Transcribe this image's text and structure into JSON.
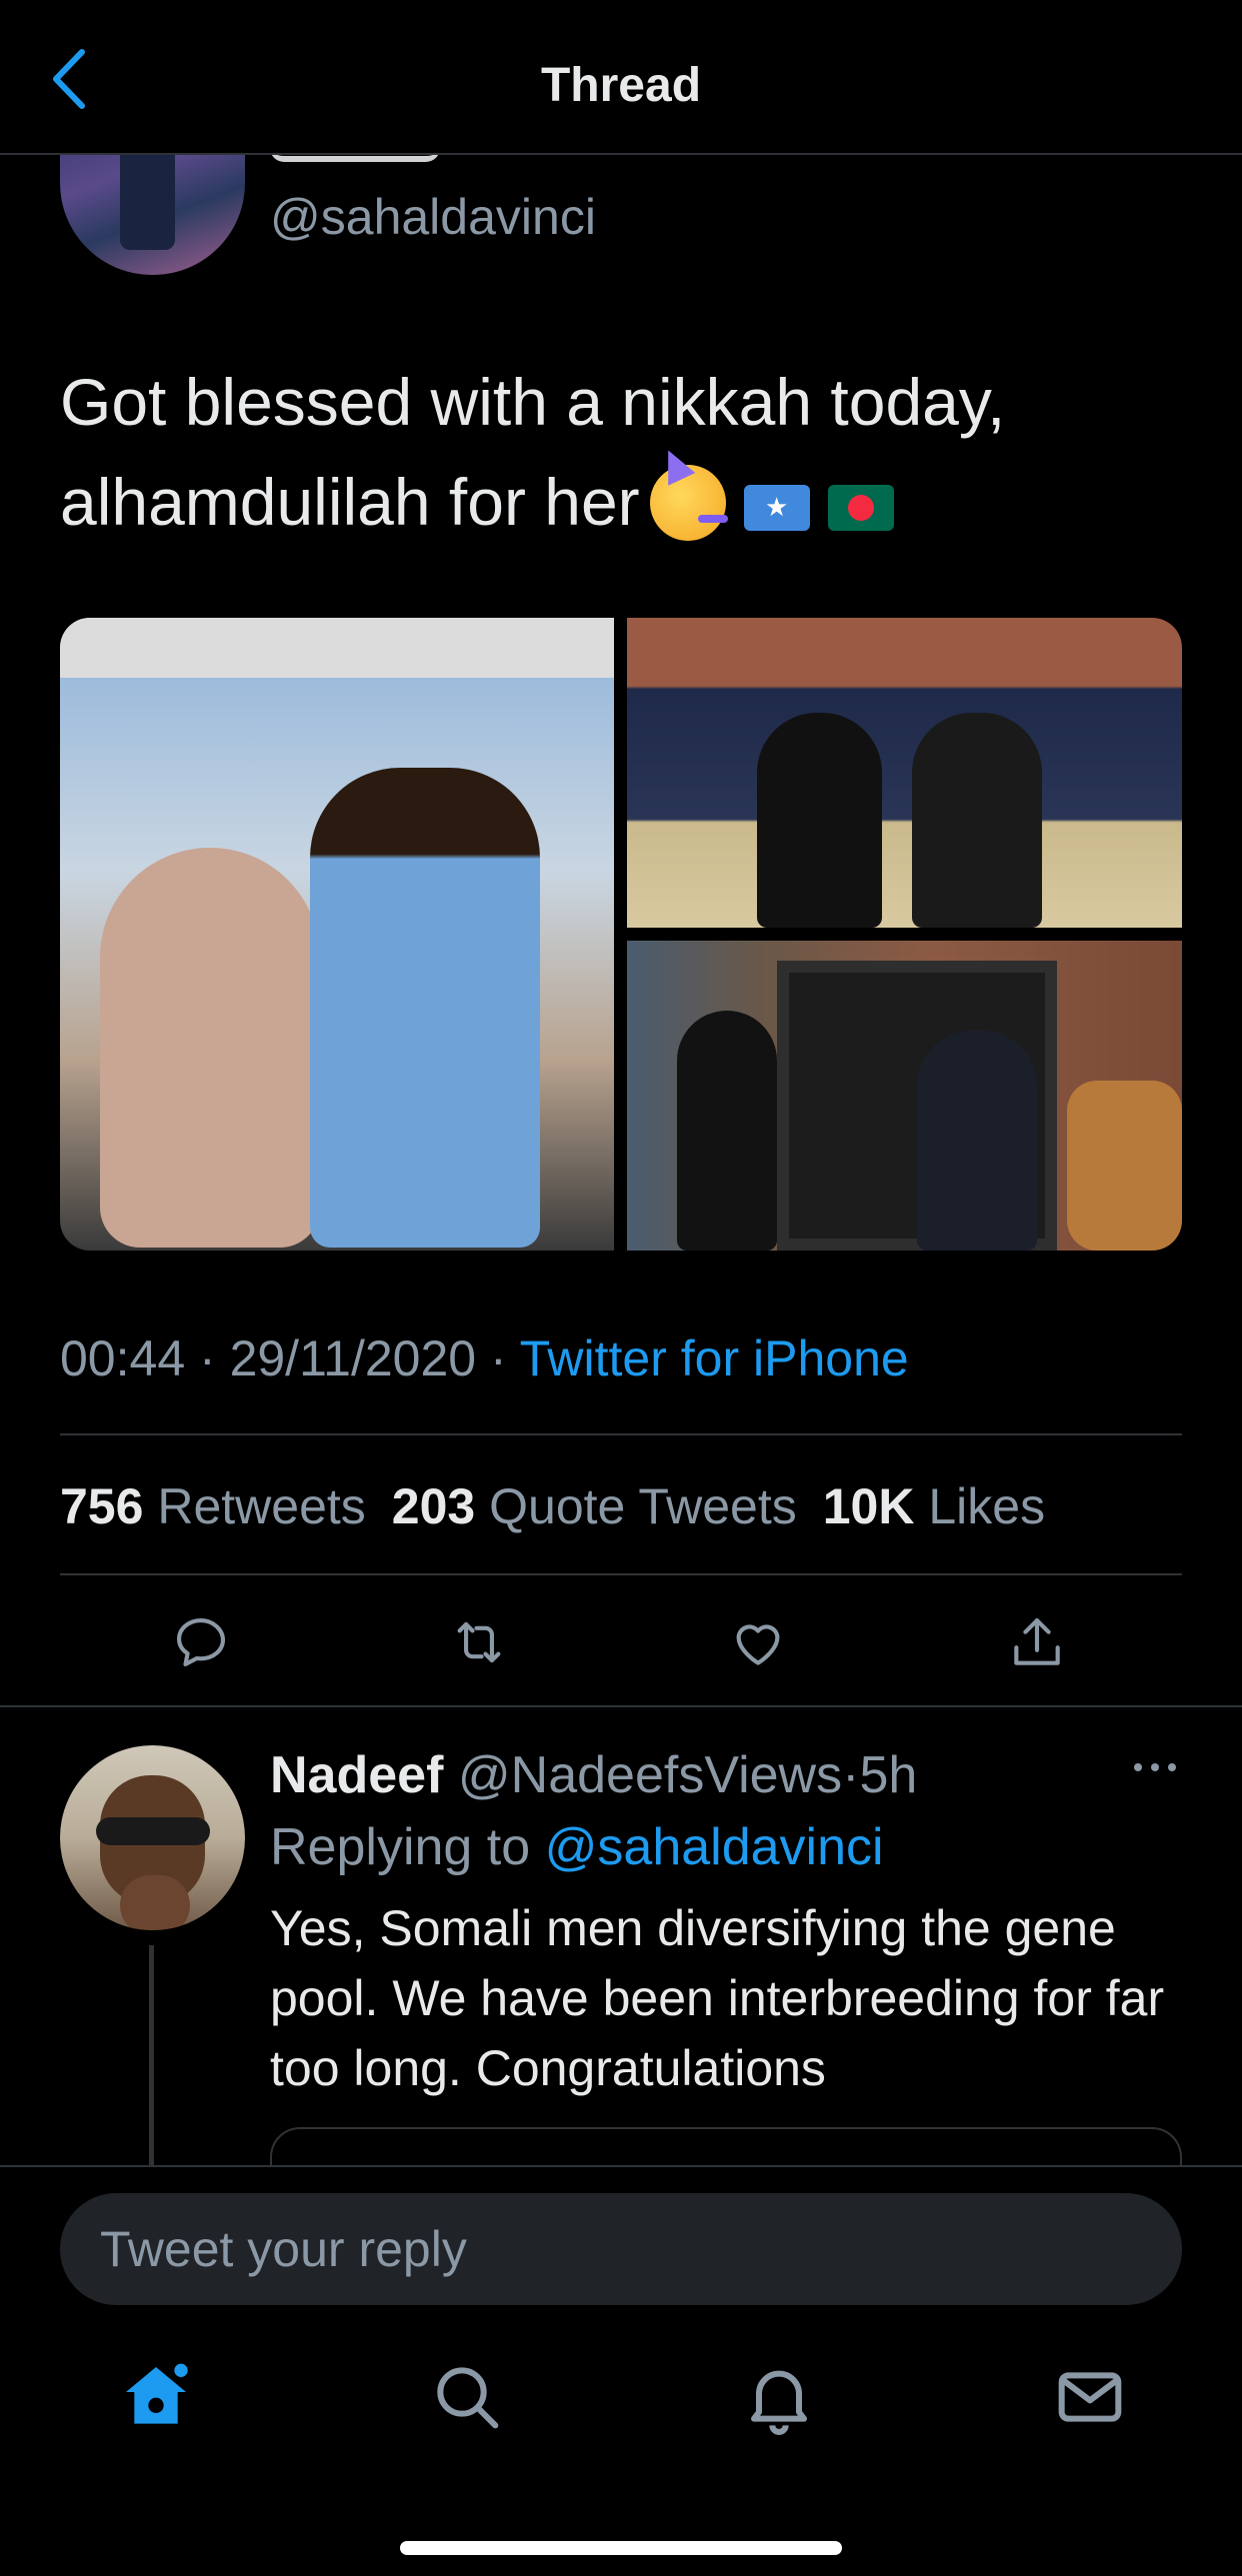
{
  "header": {
    "title": "Thread"
  },
  "tweet": {
    "handle": "@sahaldavinci",
    "text": "Got blessed with a nikkah today, alhamdulilah for her",
    "emoji_icons": [
      "partying-face-icon",
      "somalia-flag-icon",
      "bangladesh-flag-icon"
    ],
    "time": "00:44",
    "date": "29/11/2020",
    "source": "Twitter for iPhone",
    "stats": {
      "retweets_count": "756",
      "retweets_label": "Retweets",
      "quotes_count": "203",
      "quotes_label": "Quote Tweets",
      "likes_count": "10K",
      "likes_label": "Likes"
    },
    "actions": [
      "reply-icon",
      "retweet-icon",
      "like-icon",
      "share-icon"
    ]
  },
  "reply": {
    "name": "Nadeef",
    "handle": "@NadeefsViews",
    "age": "5h",
    "replying_label": "Replying to",
    "replying_to": "@sahaldavinci",
    "text": "Yes, Somali men diversifying the gene pool. We have been interbreeding for far too long. Congratulations"
  },
  "composer": {
    "placeholder": "Tweet your reply"
  },
  "tabs": [
    "home-icon",
    "search-icon",
    "notifications-icon",
    "messages-icon"
  ],
  "colors": {
    "background": "#000000",
    "accent": "#1d9bf0",
    "muted": "#8b98a5",
    "text": "#e7e9ea"
  }
}
